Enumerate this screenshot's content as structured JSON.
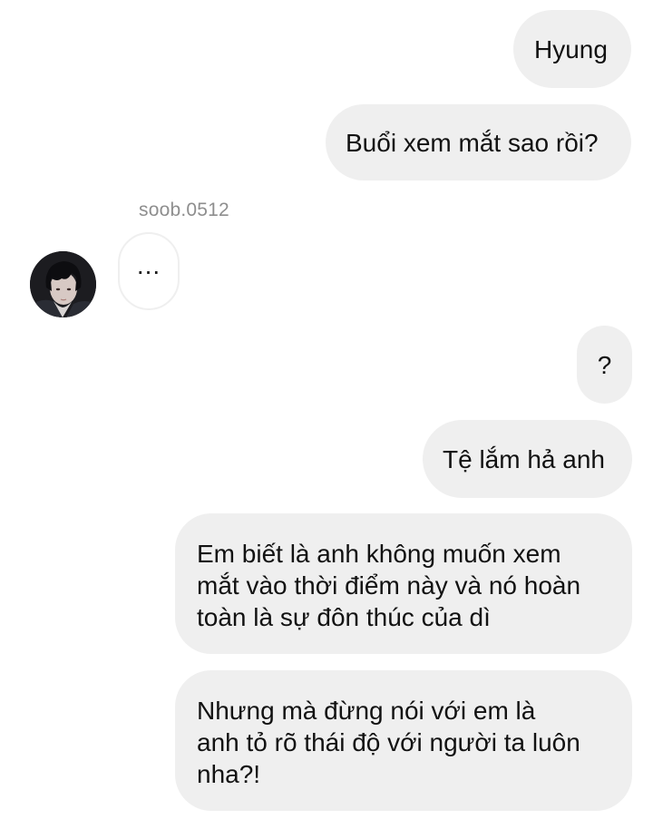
{
  "conversation": {
    "messages": [
      {
        "sender": "me",
        "text": "Hyung"
      },
      {
        "sender": "me",
        "text": "Buổi xem mắt sao rồi?"
      },
      {
        "sender": "soob.0512",
        "text": "..."
      },
      {
        "sender": "me",
        "text": "?"
      },
      {
        "sender": "me",
        "text": "Tệ lắm hả anh"
      },
      {
        "sender": "me",
        "text": "Em biết là anh không muốn xem\nmắt vào thời điểm này và nó hoàn\ntoàn là sự đôn thúc của dì"
      },
      {
        "sender": "me",
        "text": "Nhưng mà đừng nói với em là\nanh tỏ rõ thái độ với người ta luôn\nnha?!"
      }
    ],
    "other_user": {
      "username": "soob.0512",
      "avatar_icon": "profile-photo"
    }
  },
  "colors": {
    "bubble_background": "#efefef",
    "username_text": "#8e8e8e"
  }
}
